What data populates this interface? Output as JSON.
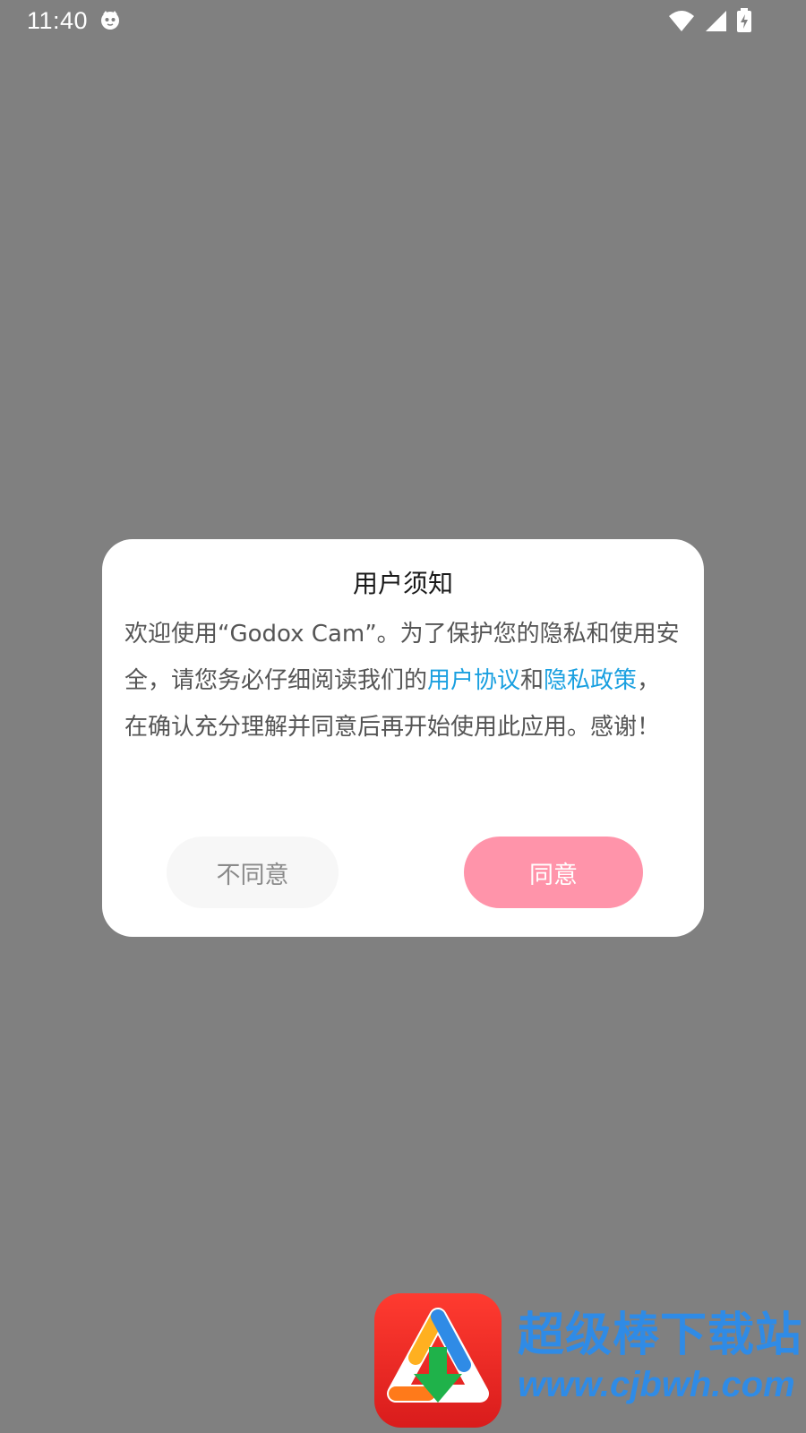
{
  "status_bar": {
    "time": "11:40",
    "icons": [
      "app-notification-icon",
      "wifi-icon",
      "cell-signal-icon",
      "battery-charging-icon"
    ]
  },
  "dialog": {
    "title": "用户须知",
    "body_text_1": "欢迎使用“Godox Cam”。为了保护您的隐私和使用安全，请您务必仔细阅读我们的",
    "link_user_agreement": "用户协议",
    "body_text_2": "和",
    "link_privacy_policy": "隐私政策",
    "body_text_3": "，在确认充分理解并同意后再开始使用此应用。感谢！",
    "disagree_label": "不同意",
    "agree_label": "同意"
  },
  "watermark": {
    "title": "超级棒下载站",
    "url": "www.cjbwh.com"
  },
  "colors": {
    "overlay": "#808080",
    "link": "#1aa0e0",
    "agree_button": "#ff94aa",
    "watermark_text": "#2f8be6"
  }
}
